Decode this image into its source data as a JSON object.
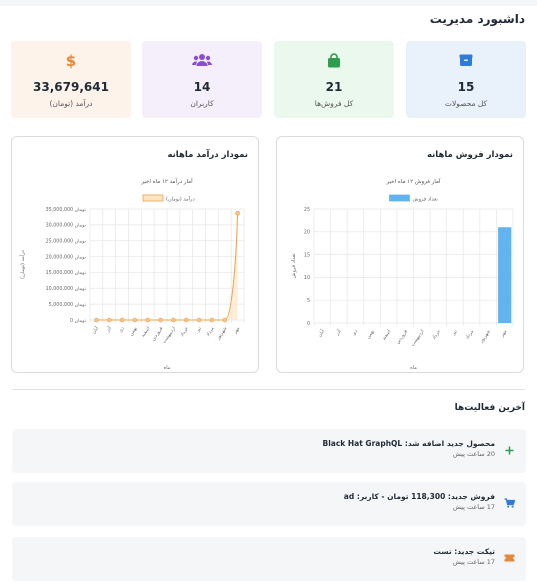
{
  "page": {
    "title": "داشبورد مدیریت"
  },
  "stats": [
    {
      "value": "15",
      "label": "کل محصولات",
      "icon": "box-icon",
      "bg": "#e9f1fb",
      "color": "#2f7bd6"
    },
    {
      "value": "21",
      "label": "کل فروش‌ها",
      "icon": "shopping-bag-icon",
      "bg": "#ebf8ee",
      "color": "#2e9e4e"
    },
    {
      "value": "14",
      "label": "کاربران",
      "icon": "users-icon",
      "bg": "#f5effb",
      "color": "#8a4fd0"
    },
    {
      "value": "33,679,641",
      "label": "درآمد (تومان)",
      "icon": "dollar-icon",
      "bg": "#fdf3ea",
      "color": "#e6873a"
    }
  ],
  "sales_card": {
    "title": "نمودار فروش ماهانه"
  },
  "revenue_card": {
    "title": "نمودار درآمد ماهانه"
  },
  "chart_data": [
    {
      "type": "bar",
      "title": "آمار فروش ۱۲ ماه اخیر",
      "xlabel": "ماه",
      "ylabel": "تعداد فروش",
      "ylim": [
        0,
        25
      ],
      "yticks": [
        "0",
        "5",
        "10",
        "15",
        "20",
        "25"
      ],
      "categories": [
        "آبان",
        "آذر",
        "دی",
        "بهمن",
        "اسفند",
        "فروردین",
        "اردیبهشت",
        "خرداد",
        "تیر",
        "مرداد",
        "شهریور",
        "مهر"
      ],
      "series": [
        {
          "name": "تعداد فروش",
          "values": [
            0,
            0,
            0,
            0,
            0,
            0,
            0,
            0,
            0,
            0,
            0,
            21
          ],
          "color": "#62b4ee"
        }
      ],
      "legend": "top"
    },
    {
      "type": "area",
      "title": "آمار درآمد ۱۲ ماه اخیر",
      "xlabel": "ماه",
      "ylabel": "درآمد (تومان)",
      "ylim": [
        0,
        35000000
      ],
      "yticks": [
        "0 تومان",
        "5,000,000 تومان",
        "10,000,000 تومان",
        "15,000,000 تومان",
        "20,000,000 تومان",
        "25,000,000 تومان",
        "30,000,000 تومان",
        "35,000,000 تومان"
      ],
      "categories": [
        "آبان",
        "آذر",
        "دی",
        "بهمن",
        "اسفند",
        "فروردین",
        "اردیبهشت",
        "خرداد",
        "تیر",
        "مرداد",
        "شهریور",
        "مهر"
      ],
      "series": [
        {
          "name": "درآمد (تومان)",
          "values": [
            0,
            0,
            0,
            0,
            0,
            0,
            0,
            0,
            0,
            0,
            0,
            33679641
          ],
          "color": "#f0a04b"
        }
      ],
      "legend": "top"
    }
  ],
  "activity": {
    "title": "آخرین فعالیت‌ها",
    "items": [
      {
        "title": "محصول جدید اضافه شد: Black Hat GraphQL",
        "time": "20 ساعت پیش",
        "icon": "plus-icon",
        "color": "#2e9e4e"
      },
      {
        "title": "فروش جدید: 118,300 تومان - کاربر: ad",
        "time": "17 ساعت پیش",
        "icon": "cart-icon",
        "color": "#2f7bd6"
      },
      {
        "title": "تیکت جدید: تست",
        "time": "17 ساعت پیش",
        "icon": "ticket-icon",
        "color": "#e6873a"
      }
    ]
  }
}
